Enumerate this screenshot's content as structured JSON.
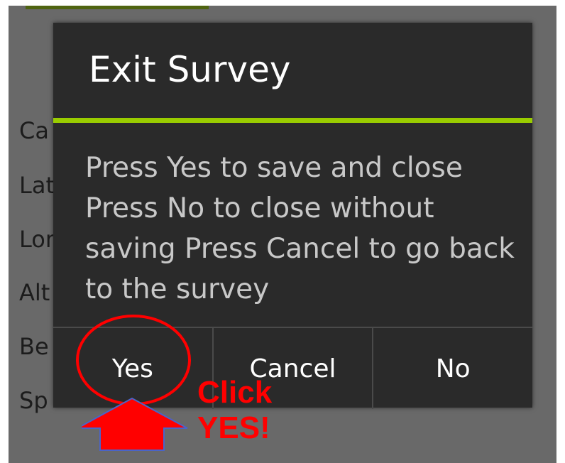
{
  "background_form": {
    "labels": [
      "Ca",
      "Lat",
      "Lon",
      "Alt",
      "Be",
      "Sp"
    ]
  },
  "dialog": {
    "title": "Exit Survey",
    "message": "Press Yes to save and close Press No to close without saving Press Cancel to go back to the survey",
    "buttons": {
      "yes": "Yes",
      "cancel": "Cancel",
      "no": "No"
    }
  },
  "annotation": {
    "line1": "Click",
    "line2": "YES!"
  },
  "colors": {
    "accent": "#99cc00",
    "dialog_bg": "#2a2a2a",
    "annotation": "#ff0000"
  }
}
